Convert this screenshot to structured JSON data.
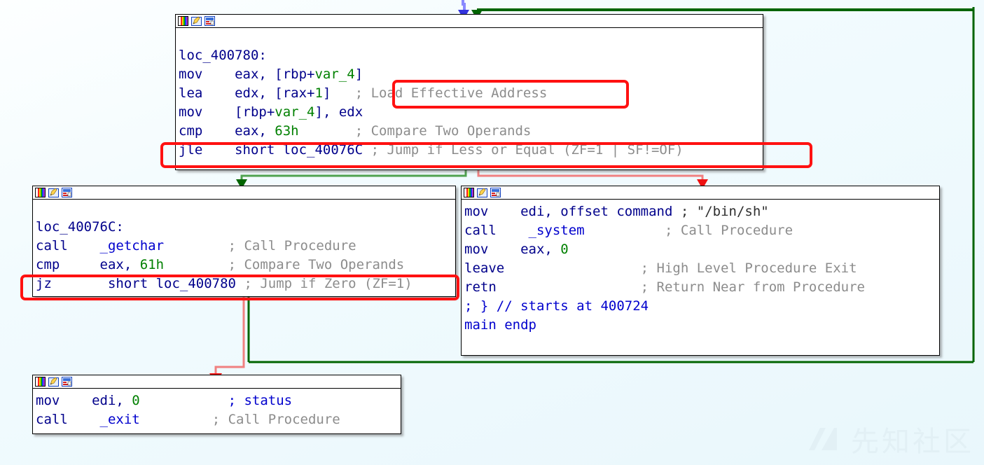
{
  "app": {
    "view": "IDA Pro graph view",
    "background_color": "#eef8fc",
    "node_border_color": "#000000",
    "highlight_color": "#ff1111",
    "edge_true_color": "#006400",
    "edge_false_color": "#f08080",
    "edge_loop_color": "#8a8aff"
  },
  "titlebar_icons": [
    {
      "name": "color-palette-icon",
      "label": "palette"
    },
    {
      "name": "edit-pencil-icon",
      "label": "edit"
    },
    {
      "name": "graph-node-icon",
      "label": "graph"
    }
  ],
  "blocks": [
    {
      "id": "block-loc-400780",
      "label": "loc_400780",
      "lines": [
        {
          "label": "loc_400780:",
          "mnemonic": "",
          "operands": "loc_400780:",
          "comment": ""
        },
        {
          "label": "",
          "mnemonic": "mov",
          "operands": "eax, [rbp+var_4]",
          "comment": ""
        },
        {
          "label": "",
          "mnemonic": "lea",
          "operands": "edx, [rax+1]",
          "comment": "; Load Effective Address"
        },
        {
          "label": "",
          "mnemonic": "mov",
          "operands": "[rbp+var_4], edx",
          "comment": ""
        },
        {
          "label": "",
          "mnemonic": "cmp",
          "operands": "eax, 63h",
          "comment": "; Compare Two Operands"
        },
        {
          "label": "",
          "mnemonic": "jle",
          "operands": "short loc_40076C",
          "comment": "; Jump if Less or Equal (ZF=1 | SF!=OF)"
        }
      ]
    },
    {
      "id": "block-loc-40076c",
      "label": "loc_40076C",
      "lines": [
        {
          "label": "loc_40076C:",
          "mnemonic": "",
          "operands": "loc_40076C:",
          "comment": ""
        },
        {
          "label": "",
          "mnemonic": "call",
          "operands": "_getchar",
          "comment": "; Call Procedure"
        },
        {
          "label": "",
          "mnemonic": "cmp",
          "operands": "eax, 61h",
          "comment": "; Compare Two Operands"
        },
        {
          "label": "",
          "mnemonic": "jz",
          "operands": "short loc_400780",
          "comment": "; Jump if Zero (ZF=1)"
        }
      ]
    },
    {
      "id": "block-system",
      "label": "system block",
      "lines": [
        {
          "label": "",
          "mnemonic": "mov",
          "operands": "edi, offset command",
          "comment": "; \"/bin/sh\""
        },
        {
          "label": "",
          "mnemonic": "call",
          "operands": "_system",
          "comment": "; Call Procedure"
        },
        {
          "label": "",
          "mnemonic": "mov",
          "operands": "eax, 0",
          "comment": ""
        },
        {
          "label": "",
          "mnemonic": "leave",
          "operands": "",
          "comment": "; High Level Procedure Exit"
        },
        {
          "label": "",
          "mnemonic": "retn",
          "operands": "",
          "comment": "; Return Near from Procedure"
        },
        {
          "label": "",
          "mnemonic": "",
          "operands": "; } // starts at 400724",
          "comment": ""
        },
        {
          "label": "",
          "mnemonic": "main endp",
          "operands": "",
          "comment": ""
        }
      ]
    },
    {
      "id": "block-exit",
      "label": "exit block",
      "lines": [
        {
          "label": "",
          "mnemonic": "mov",
          "operands": "edi, 0",
          "comment": "; status"
        },
        {
          "label": "",
          "mnemonic": "call",
          "operands": "_exit",
          "comment": "; Call Procedure"
        }
      ]
    }
  ],
  "code": {
    "b1": {
      "l1_loc": "loc_400780:",
      "l2_m": "mov",
      "l2_o1": "eax, [rbp+",
      "l2_var": "var_4",
      "l2_o2": "]",
      "l3_m": "lea",
      "l3_o1": "edx, [rax+",
      "l3_num": "1",
      "l3_o2": "]",
      "l3_c": "; Load Effective Address",
      "l4_m": "mov",
      "l4_o1": "[rbp+",
      "l4_var": "var_4",
      "l4_o2": "], edx",
      "l5_m": "cmp",
      "l5_o1": "eax, ",
      "l5_num": "63h",
      "l5_c": "; Compare Two Operands",
      "l6_m": "jle",
      "l6_o": "short loc_40076C",
      "l6_c": "; Jump if Less or Equal (ZF=1 | SF!=OF)"
    },
    "b2": {
      "l1_loc": "loc_40076C:",
      "l2_m": "call",
      "l2_o": "_getchar",
      "l2_c": "; Call Procedure",
      "l3_m": "cmp",
      "l3_o1": "eax, ",
      "l3_num": "61h",
      "l3_c": "; Compare Two Operands",
      "l4_m": "jz",
      "l4_o": "short loc_400780",
      "l4_c": "; Jump if Zero (ZF=1)"
    },
    "b3": {
      "l1_m": "mov",
      "l1_o": "edi, offset command",
      "l1_c": "; \"/bin/sh\"",
      "l2_m": "call",
      "l2_o": "_system",
      "l2_c": "; Call Procedure",
      "l3_m": "mov",
      "l3_o1": "eax, ",
      "l3_num": "0",
      "l4_m": "leave",
      "l4_c": "; High Level Procedure Exit",
      "l5_m": "retn",
      "l5_c": "; Return Near from Procedure",
      "l6_t": "; } // starts at 400724",
      "l7_t": "main endp"
    },
    "b4": {
      "l1_m": "mov",
      "l1_o1": "edi, ",
      "l1_num": "0",
      "l1_c": "; status",
      "l2_m": "call",
      "l2_o": "_exit",
      "l2_c": "; Call Procedure"
    }
  },
  "annotations": [
    {
      "name": "highlight-lea-comment",
      "text": "; Load Effective Address"
    },
    {
      "name": "highlight-jle-line",
      "text": "jle short loc_40076C ; Jump if Less or Equal (ZF=1 | SF!=OF)"
    },
    {
      "name": "highlight-jz-line",
      "text": "jz short loc_400780 ; Jump if Zero (ZF=1)"
    }
  ],
  "watermark": {
    "text": "先知社区"
  }
}
